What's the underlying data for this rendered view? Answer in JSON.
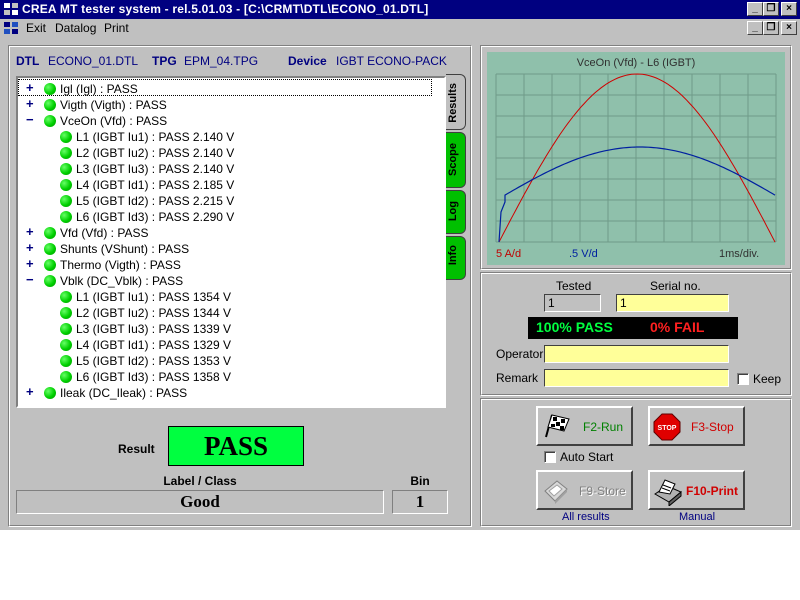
{
  "window": {
    "title": "CREA  MT tester system - rel.5.01.03 - [C:\\CRMT\\DTL\\ECONO_01.DTL]",
    "controls": [
      "_",
      "❐",
      "×"
    ]
  },
  "menu": [
    "Exit",
    "Datalog",
    "Print"
  ],
  "header": {
    "dtl_key": "DTL",
    "dtl_val": "ECONO_01.DTL",
    "tpg_key": "TPG",
    "tpg_val": "EPM_04.TPG",
    "device_key": "Device",
    "device_val": "IGBT ECONO-PACK"
  },
  "tabs": [
    "Results",
    "Scope",
    "Log",
    "Info"
  ],
  "tree": [
    {
      "text": "Igl (Igl) : PASS",
      "level": 0,
      "expand": "+"
    },
    {
      "text": "Vigth (Vigth) : PASS",
      "level": 0,
      "expand": "+"
    },
    {
      "text": "VceOn (Vfd) : PASS",
      "level": 0,
      "expand": "-"
    },
    {
      "text": "L1 (IGBT Iu1) : PASS 2.140 V",
      "level": 1,
      "expand": ""
    },
    {
      "text": "L2 (IGBT Iu2) : PASS 2.140 V",
      "level": 1,
      "expand": ""
    },
    {
      "text": "L3 (IGBT Iu3) : PASS 2.140 V",
      "level": 1,
      "expand": ""
    },
    {
      "text": "L4 (IGBT Id1) : PASS 2.185 V",
      "level": 1,
      "expand": ""
    },
    {
      "text": "L5 (IGBT Id2) : PASS 2.215 V",
      "level": 1,
      "expand": ""
    },
    {
      "text": "L6 (IGBT Id3) : PASS 2.290 V",
      "level": 1,
      "expand": ""
    },
    {
      "text": "Vfd (Vfd) : PASS",
      "level": 0,
      "expand": "+"
    },
    {
      "text": "Shunts (VShunt) : PASS",
      "level": 0,
      "expand": "+"
    },
    {
      "text": "Thermo (Vigth) : PASS",
      "level": 0,
      "expand": "+"
    },
    {
      "text": "Vblk (DC_Vblk) : PASS",
      "level": 0,
      "expand": "-"
    },
    {
      "text": "L1 (IGBT Iu1) : PASS 1354 V",
      "level": 1,
      "expand": ""
    },
    {
      "text": "L2 (IGBT Iu2) : PASS 1344 V",
      "level": 1,
      "expand": ""
    },
    {
      "text": "L3 (IGBT Iu3) : PASS 1339 V",
      "level": 1,
      "expand": ""
    },
    {
      "text": "L4 (IGBT Id1) : PASS 1329 V",
      "level": 1,
      "expand": ""
    },
    {
      "text": "L5 (IGBT Id2) : PASS 1353 V",
      "level": 1,
      "expand": ""
    },
    {
      "text": "L6 (IGBT Id3) : PASS 1358 V",
      "level": 1,
      "expand": ""
    },
    {
      "text": "Ileak (DC_Ileak) : PASS",
      "level": 0,
      "expand": "+"
    }
  ],
  "result": {
    "label": "Result",
    "value": "PASS",
    "class_label": "Label / Class",
    "class_value": "Good",
    "bin_label": "Bin",
    "bin_value": "1"
  },
  "scope": {
    "title": "VceOn (Vfd)  - L6 (IGBT)",
    "scale_a": "5 A/d",
    "scale_v": ".5 V/d",
    "scale_t": "1ms/div.",
    "bg": "#8fc0ab",
    "grid": "#6f9a88",
    "red": "#d00000",
    "blue": "#0020a0"
  },
  "stats": {
    "tested_label": "Tested",
    "tested_value": "1",
    "serial_label": "Serial no.",
    "serial_value": "1",
    "pass_text": "100% PASS",
    "fail_text": "0% FAIL",
    "operator_label": "Operator",
    "operator_value": "",
    "remark_label": "Remark",
    "remark_value": "",
    "keep_label": "Keep"
  },
  "buttons": {
    "run": "F2-Run",
    "stop": "F3-Stop",
    "auto_start": "Auto Start",
    "store": "F9-Store",
    "print": "F10-Print",
    "all_results": "All results",
    "manual": "Manual"
  }
}
